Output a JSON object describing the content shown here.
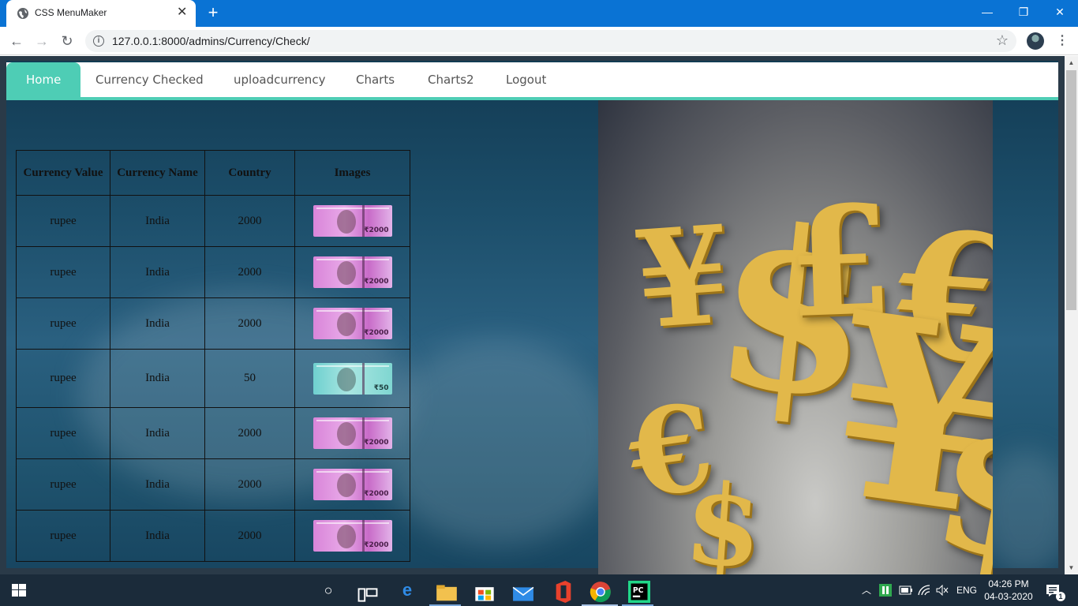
{
  "browser": {
    "tab_title": "CSS MenuMaker",
    "tab_close": "✕",
    "new_tab": "+",
    "url": "127.0.0.1:8000/admins/Currency/Check/",
    "window_controls": {
      "minimize": "—",
      "restore": "❐",
      "close": "✕"
    },
    "nav": {
      "back": "←",
      "forward": "→",
      "reload": "↻"
    },
    "bookmark_icon": "☆",
    "menu_icon": "⋮"
  },
  "menu": {
    "items": [
      {
        "label": "Home",
        "active": true
      },
      {
        "label": "Currency Checked"
      },
      {
        "label": "uploadcurrency"
      },
      {
        "label": "Charts"
      },
      {
        "label": "Charts2"
      },
      {
        "label": "Logout"
      }
    ]
  },
  "table": {
    "headers": [
      "Currency Value",
      "Currency Name",
      "Country",
      "Images"
    ],
    "rows": [
      {
        "value": "rupee",
        "name": "India",
        "country": "2000",
        "note": "2000",
        "note_label": "₹2000"
      },
      {
        "value": "rupee",
        "name": "India",
        "country": "2000",
        "note": "2000",
        "note_label": "₹2000"
      },
      {
        "value": "rupee",
        "name": "India",
        "country": "2000",
        "note": "2000",
        "note_label": "₹2000"
      },
      {
        "value": "rupee",
        "name": "India",
        "country": "50",
        "note": "50",
        "note_label": "₹50"
      },
      {
        "value": "rupee",
        "name": "India",
        "country": "2000",
        "note": "2000",
        "note_label": "₹2000"
      },
      {
        "value": "rupee",
        "name": "India",
        "country": "2000",
        "note": "2000",
        "note_label": "₹2000"
      },
      {
        "value": "rupee",
        "name": "India",
        "country": "2000",
        "note": "2000",
        "note_label": "₹2000"
      }
    ]
  },
  "hero": {
    "symbols": [
      "¥",
      "$",
      "£",
      "€",
      "¥",
      "€",
      "$",
      "$"
    ]
  },
  "taskbar": {
    "language": "ENG",
    "time": "04:26 PM",
    "date": "04-03-2020",
    "notifications": "1"
  },
  "colors": {
    "accent": "#4ecdb5",
    "chrome_blue": "#0a73d4",
    "taskbar": "#1b2b3a"
  }
}
